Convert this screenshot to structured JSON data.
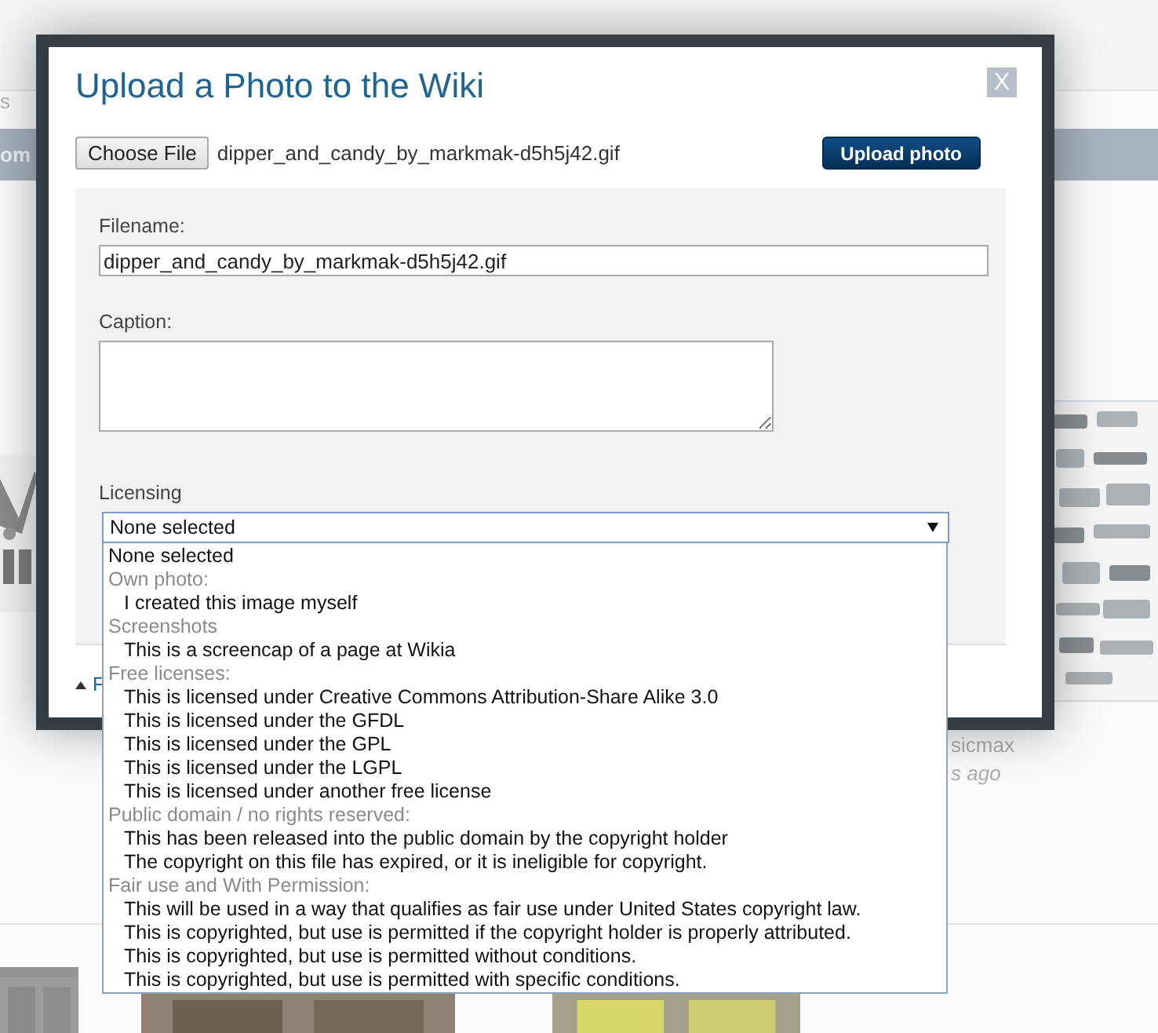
{
  "background": {
    "tab_fragment": "s",
    "bar_fragment": "om",
    "author_fragment": "sicmax",
    "time_fragment": "s ago"
  },
  "dialog": {
    "title": "Upload a Photo to the Wiki",
    "close": "X",
    "file_button": "Choose File",
    "file_name": "dipper_and_candy_by_markmak-d5h5j42.gif",
    "upload_button": "Upload photo",
    "fields": [
      {
        "kind": "input",
        "label": "Filename:",
        "value": "dipper_and_candy_by_markmak-d5h5j42.gif"
      },
      {
        "kind": "textarea",
        "label": "Caption:"
      }
    ],
    "licensing": {
      "label": "Licensing",
      "value": "None selected",
      "expanded": true,
      "options": [
        {
          "kind": "option",
          "label": "None selected"
        },
        {
          "kind": "group",
          "label": "Own photo:",
          "children": [
            {
              "label": "I created this image myself"
            }
          ]
        },
        {
          "kind": "group",
          "label": "Screenshots",
          "children": [
            {
              "label": "This is a screencap of a page at Wikia"
            }
          ]
        },
        {
          "kind": "group",
          "label": "Free licenses:",
          "children": [
            {
              "label": "This is licensed under Creative Commons Attribution-Share Alike 3.0"
            },
            {
              "label": "This is licensed under the GFDL"
            },
            {
              "label": "This is licensed under the GPL"
            },
            {
              "label": "This is licensed under the LGPL"
            },
            {
              "label": "This is licensed under another free license"
            }
          ]
        },
        {
          "kind": "group",
          "label": "Public domain / no rights reserved:",
          "children": [
            {
              "label": "This has been released into the public domain by the copyright holder"
            },
            {
              "label": "The copyright on this file has expired, or it is ineligible for copyright."
            }
          ]
        },
        {
          "kind": "group",
          "label": "Fair use and With Permission:",
          "children": [
            {
              "label": "This will be used in a way that qualifies as fair use under United States copyright law."
            },
            {
              "label": "This is copyrighted, but use is permitted if the copyright holder is properly attributed."
            },
            {
              "label": "This is copyrighted, but use is permitted without conditions."
            },
            {
              "label": "This is copyrighted, but use is permitted with specific conditions."
            }
          ]
        }
      ]
    },
    "footer_link": "F"
  }
}
